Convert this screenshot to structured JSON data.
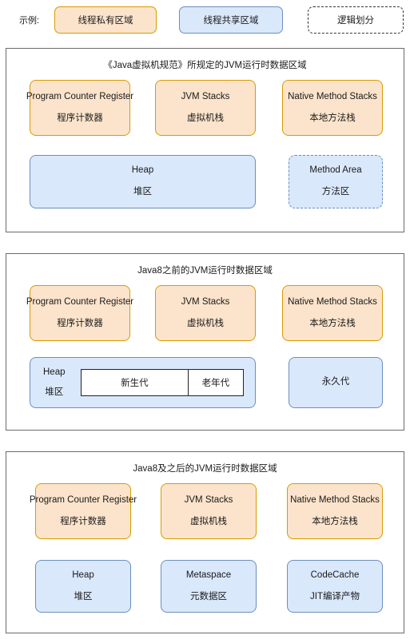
{
  "legend": {
    "label": "示例:",
    "items": [
      {
        "name": "thread-private",
        "text": "线程私有区域",
        "fill": "#fce4cc",
        "stroke": "#d79b00",
        "style": "solid"
      },
      {
        "name": "thread-shared",
        "text": "线程共享区域",
        "fill": "#dae8fc",
        "stroke": "#6c8ebf",
        "style": "solid"
      },
      {
        "name": "logical-division",
        "text": "逻辑划分",
        "fill": "#ffffff",
        "stroke": "#333333",
        "style": "dashed"
      }
    ]
  },
  "sections": [
    {
      "id": "spec",
      "title": "《Java虚拟机规范》所规定的JVM运行时数据区域",
      "top_row": [
        {
          "en": "Program Counter Register",
          "cn": "程序计数器"
        },
        {
          "en": "JVM Stacks",
          "cn": "虚拟机栈"
        },
        {
          "en": "Native Method Stacks",
          "cn": "本地方法栈"
        }
      ],
      "bottom_row": [
        {
          "en": "Heap",
          "cn": "堆区"
        },
        {
          "en": "Method Area",
          "cn": "方法区"
        }
      ]
    },
    {
      "id": "pre-java8",
      "title": "Java8之前的JVM运行时数据区域",
      "top_row": [
        {
          "en": "Program Counter Register",
          "cn": "程序计数器"
        },
        {
          "en": "JVM Stacks",
          "cn": "虚拟机栈"
        },
        {
          "en": "Native Method Stacks",
          "cn": "本地方法栈"
        }
      ],
      "heap": {
        "en": "Heap",
        "cn": "堆区",
        "generations": [
          "新生代",
          "老年代"
        ]
      },
      "permgen": {
        "cn": "永久代"
      }
    },
    {
      "id": "java8-plus",
      "title": "Java8及之后的JVM运行时数据区域",
      "top_row": [
        {
          "en": "Program Counter Register",
          "cn": "程序计数器"
        },
        {
          "en": "JVM Stacks",
          "cn": "虚拟机栈"
        },
        {
          "en": "Native Method Stacks",
          "cn": "本地方法栈"
        }
      ],
      "bottom_row": [
        {
          "en": "Heap",
          "cn": "堆区"
        },
        {
          "en": "Metaspace",
          "cn": "元数据区"
        },
        {
          "en": "CodeCache",
          "cn": "JIT编译产物"
        }
      ]
    }
  ],
  "colors": {
    "thread_private_fill": "#fce4cc",
    "thread_private_stroke": "#d79b00",
    "thread_shared_fill": "#dae8fc",
    "thread_shared_stroke": "#6c8ebf",
    "container_stroke": "#6b6b6b",
    "logical_stroke": "#333333",
    "generation_stroke": "#222222",
    "text": "#1a1a1a"
  }
}
